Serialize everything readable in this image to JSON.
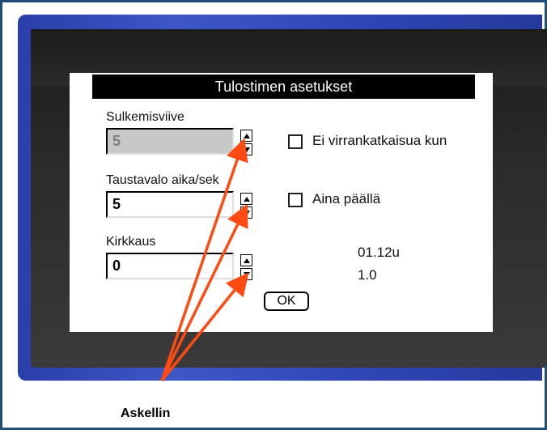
{
  "dialog": {
    "title": "Tulostimen asetukset",
    "shutdown_delay": {
      "label": "Sulkemisviive",
      "value": "5"
    },
    "backlight_time": {
      "label": "Taustavalo aika/sek",
      "value": "5"
    },
    "brightness": {
      "label": "Kirkkaus",
      "value": "0"
    },
    "checkbox_no_power_off": {
      "label": "Ei virrankatkaisua kun",
      "checked": false
    },
    "checkbox_always_on": {
      "label": "Aina päällä",
      "checked": false
    },
    "version_line1": "01.12u",
    "version_line2": "1.0",
    "ok_label": "OK"
  },
  "annotation": {
    "caption": "Askellin",
    "arrow_color": "#ff4a12"
  },
  "colors": {
    "bezel_blue": "#3d56c8",
    "frame_border": "#1f4e7a"
  }
}
